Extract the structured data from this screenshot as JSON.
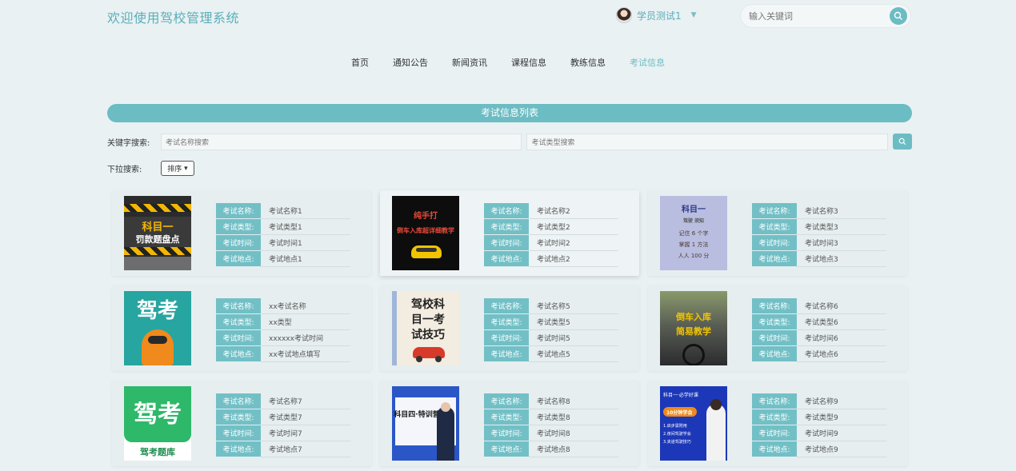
{
  "header": {
    "title": "欢迎使用驾校管理系统",
    "user": "学员测试1",
    "search_placeholder": "输入关键词"
  },
  "nav": [
    "首页",
    "通知公告",
    "新闻资讯",
    "课程信息",
    "教练信息",
    "考试信息"
  ],
  "nav_active_index": 5,
  "list_title": "考试信息列表",
  "filter": {
    "keyword_label": "关键字搜索:",
    "name_placeholder": "考试名称搜索",
    "type_placeholder": "考试类型搜索",
    "dropdown_label": "下拉搜索:",
    "sort_label": "排序"
  },
  "field_labels": [
    "考试名称:",
    "考试类型:",
    "考试时间:",
    "考试地点:"
  ],
  "cards": [
    {
      "values": [
        "考试名称1",
        "考试类型1",
        "考试时间1",
        "考试地点1"
      ],
      "thumb": {
        "kind": "hazard",
        "line1": "科目一",
        "line2": "罚款题盘点"
      }
    },
    {
      "values": [
        "考试名称2",
        "考试类型2",
        "考试时间2",
        "考试地点2"
      ],
      "thumb": {
        "kind": "dark",
        "line1": "纯手打",
        "line2": "倒车入库超详细教学"
      }
    },
    {
      "values": [
        "考试名称3",
        "考试类型3",
        "考试时间3",
        "考试地点3"
      ],
      "thumb": {
        "kind": "lavender",
        "line1": "科目一",
        "line2": "驾驶 须知",
        "line3": "记住 6 个字",
        "line4": "掌握 1 方法",
        "line5": "人人 100 分"
      }
    },
    {
      "values": [
        "xx考试名称",
        "xx类型",
        "xxxxxx考试时间",
        "xx考试地点填写"
      ],
      "thumb": {
        "kind": "jiakao",
        "line1": "驾考"
      }
    },
    {
      "values": [
        "考试名称5",
        "考试类型5",
        "考试时间5",
        "考试地点5"
      ],
      "thumb": {
        "kind": "notebook",
        "line1": "驾校科",
        "line2": "目一考",
        "line3": "试技巧"
      }
    },
    {
      "values": [
        "考试名称6",
        "考试类型6",
        "考试时间6",
        "考试地点6"
      ],
      "thumb": {
        "kind": "cockpit",
        "line1": "倒车入库",
        "line2": "简易教学"
      }
    },
    {
      "values": [
        "考试名称7",
        "考试类型7",
        "考试时间7",
        "考试地点7"
      ],
      "thumb": {
        "kind": "tiku",
        "line1": "驾考",
        "line2": "驾考题库"
      }
    },
    {
      "values": [
        "考试名称8",
        "考试类型8",
        "考试时间8",
        "考试地点8"
      ],
      "thumb": {
        "kind": "camp",
        "line1": "科目四·特训营"
      }
    },
    {
      "values": [
        "考试名称9",
        "考试类型9",
        "考试时间9",
        "考试地点9"
      ],
      "thumb": {
        "kind": "course",
        "line1": "科目一·必学好课",
        "line2": "10分钟学会",
        "line3": "1.启步需附用",
        "line4": "2.夜间驾驶学会",
        "line5": "3.夹道驾驶技巧"
      }
    }
  ],
  "colors": {
    "accent": "#6cbcc3",
    "page_bg": "#e9f1f3"
  }
}
